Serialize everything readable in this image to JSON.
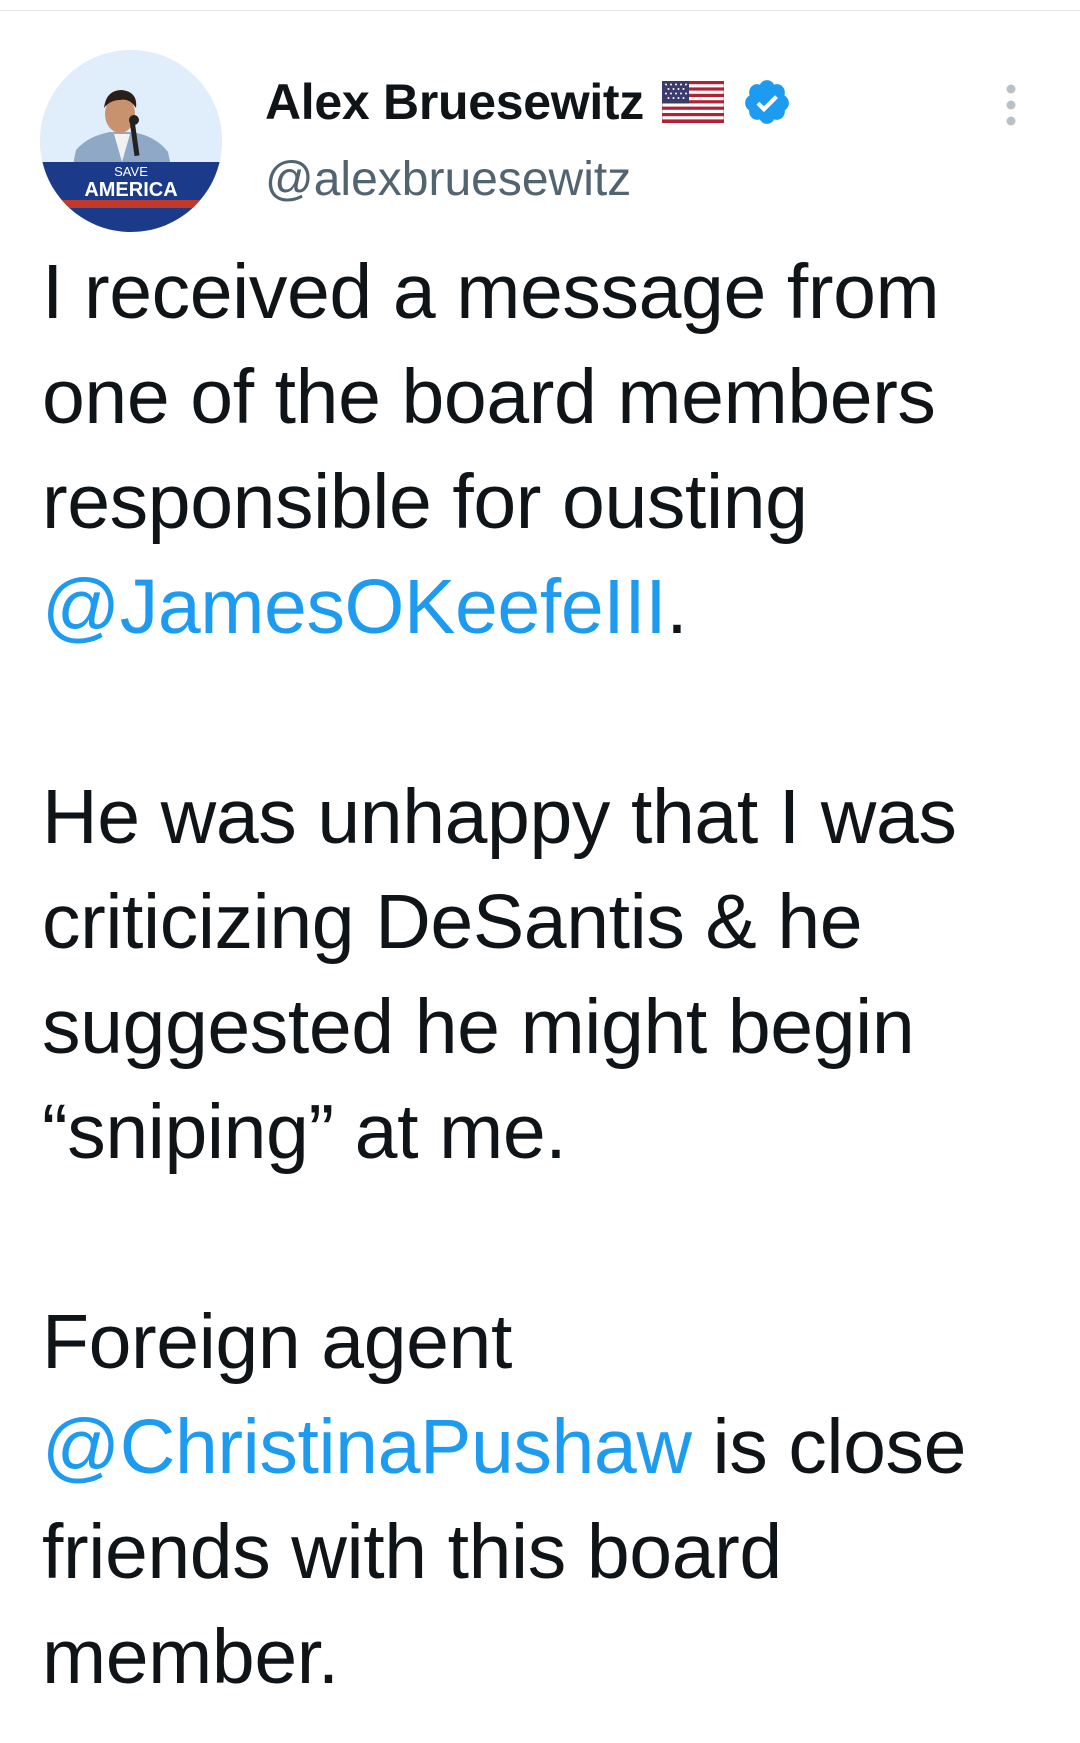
{
  "author": {
    "display_name": "Alex Bruesewitz",
    "handle": "@alexbruesewitz",
    "flag_icon": "us-flag-icon",
    "verified_icon": "verified-badge-icon",
    "avatar_banner": {
      "line1": "SAVE",
      "line2": "AMERICA"
    }
  },
  "menu_icon": "more-vertical-icon",
  "tweet": {
    "p1": {
      "text": "I received a message from one of the board members responsible for ousting ",
      "mention": "@JamesOKeefeIII",
      "tail": "."
    },
    "p2": {
      "text": "He was unhappy that I was criticizing DeSantis & he suggested he might begin “sniping” at me."
    },
    "p3": {
      "lead": "Foreign agent ",
      "mention": "@ChristinaPushaw",
      "text": " is close friends with this board member."
    }
  },
  "colors": {
    "text": "#0f1419",
    "secondary": "#536471",
    "link": "#1d9bf0",
    "verified": "#1d9bf0",
    "banner_blue": "#1b3a8a"
  }
}
